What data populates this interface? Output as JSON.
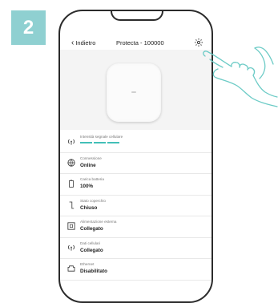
{
  "step": "2",
  "nav": {
    "back_label": "Indietro",
    "title": "Protecta - 100000",
    "settings_icon": "gear-icon"
  },
  "items": [
    {
      "icon": "signal-icon",
      "label": "Intensità segnale cellulare",
      "signal_bars": 3
    },
    {
      "icon": "globe-icon",
      "label": "Connessione",
      "value": "Online"
    },
    {
      "icon": "battery-icon",
      "label": "Carica batteria",
      "value": "100%"
    },
    {
      "icon": "lid-icon",
      "label": "Stato coperchio",
      "value": "Chiuso"
    },
    {
      "icon": "power-icon",
      "label": "Alimentazione esterna",
      "value": "Collegato"
    },
    {
      "icon": "cellular-icon",
      "label": "Dati cellulari",
      "value": "Collegato"
    },
    {
      "icon": "ethernet-icon",
      "label": "Ethernet",
      "value": "Disabilitato"
    }
  ],
  "colors": {
    "badge": "#8fd0d1",
    "accent": "#43bfb8",
    "hand_outline": "#6ccbc6"
  }
}
